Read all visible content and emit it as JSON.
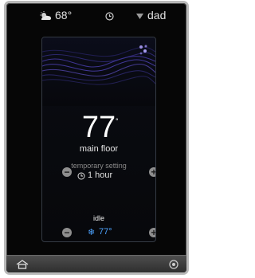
{
  "status_bar": {
    "outdoor_temp": "68°",
    "user": "dad",
    "weather_icon": "partly-cloudy-icon",
    "clock_icon": "clock-icon",
    "wifi_icon": "wifi-icon"
  },
  "thermostat": {
    "current_temp": "77",
    "degree_symbol": "°",
    "room": "main floor",
    "temporary_label": "temporary setting",
    "hold_duration": "1 hour",
    "status": "idle",
    "cool_setpoint": "77°",
    "decrease_symbol": "−",
    "increase_symbol": "+"
  },
  "bottom_bar": {
    "home_icon": "home-icon",
    "settings_icon": "settings-icon"
  },
  "colors": {
    "background": "#060606",
    "accent_cool": "#4da3ff",
    "wave": "#5a46c8"
  }
}
